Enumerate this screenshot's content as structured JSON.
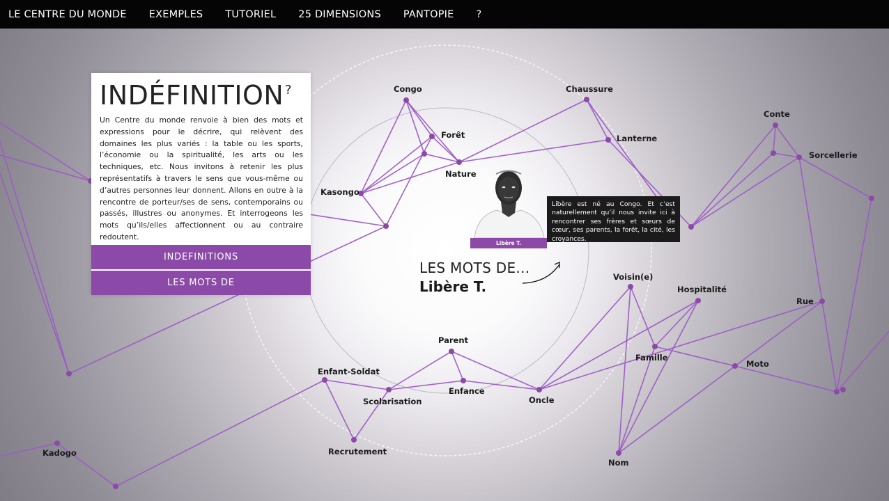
{
  "nav": {
    "items": [
      {
        "label": "LE CENTRE DU MONDE"
      },
      {
        "label": "EXEMPLES"
      },
      {
        "label": "TUTORIEL"
      },
      {
        "label": "25 DIMENSIONS"
      },
      {
        "label": "PANTOPIE"
      },
      {
        "label": "?"
      }
    ]
  },
  "panel": {
    "title": "INDÉFINITION",
    "help": "?",
    "text": "Un Centre du monde renvoie à bien des mots et expressions pour le décrire, qui relèvent des domaines les plus variés : la table ou les sports, l’économie ou la spiritualité, les arts ou les techniques, etc. Nous invitons à retenir les plus représentatifs à travers le sens que vous-même ou d’autres personnes leur donnent. Allons en outre à la rencontre de porteur/ses de sens, contemporains ou passés, illustres ou anonymes. Et interrogeons les mots qu’ils/elles affectionnent ou au contraire redoutent.",
    "buttons": {
      "indefinitions": "INDEFINITIONS",
      "mots_de": "LES MOTS DE"
    }
  },
  "person": {
    "name_badge": "Libère T.",
    "bio": "Libère est né au Congo. Et c’est naturellement qu’il nous invite ici à rencontrer ses frères et sœurs de cœur, ses parents, la forêt, la cité, les croyances."
  },
  "mots_de": {
    "line1": "LES MOTS DE...",
    "line2": "Libère T."
  },
  "colors": {
    "accent": "#8c4aa8",
    "line": "#9b5cc4",
    "nav_bg": "#050505"
  },
  "words": [
    "Congo",
    "Chaussure",
    "Forêt",
    "Lanterne",
    "Nature",
    "Kasongo",
    "Conte",
    "Sorcellerie",
    "Voisin(e)",
    "Hospitalité",
    "Rue",
    "Famille",
    "Moto",
    "Parent",
    "Enfant-Soldat",
    "Enfance",
    "Scolarisation",
    "Oncle",
    "Recrutement",
    "Kadogo",
    "Nom"
  ]
}
